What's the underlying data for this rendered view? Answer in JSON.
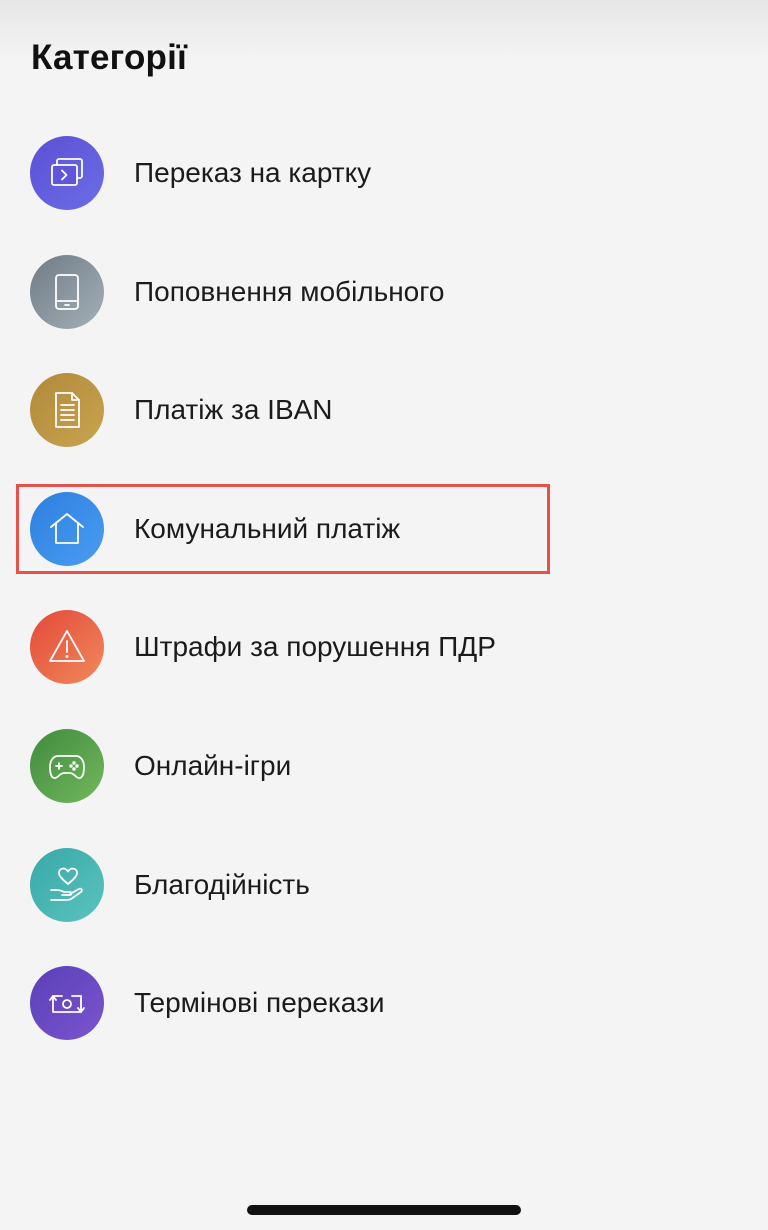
{
  "header": {
    "title": "Категорії"
  },
  "categories": [
    {
      "label": "Переказ на картку",
      "icon": "card-transfer-icon",
      "color_from": "#5b4fd6",
      "color_to": "#6c6ee6"
    },
    {
      "label": "Поповнення мобільного",
      "icon": "mobile-phone-icon",
      "color_from": "#6f7c86",
      "color_to": "#a3b0b8"
    },
    {
      "label": "Платіж за IBAN",
      "icon": "document-icon",
      "color_from": "#b08a3a",
      "color_to": "#c9a34f"
    },
    {
      "label": "Комунальний платіж",
      "icon": "home-icon",
      "color_from": "#2d7fe0",
      "color_to": "#4a9df0"
    },
    {
      "label": "Штрафи за порушення ПДР",
      "icon": "warning-icon",
      "color_from": "#e4483a",
      "color_to": "#f08a5a"
    },
    {
      "label": "Онлайн-ігри",
      "icon": "gamepad-icon",
      "color_from": "#3f8b3f",
      "color_to": "#72b85b"
    },
    {
      "label": "Благодійність",
      "icon": "charity-hand-heart-icon",
      "color_from": "#37a8a8",
      "color_to": "#5cc3be"
    },
    {
      "label": "Термінові перекази",
      "icon": "urgent-transfer-icon",
      "color_from": "#5a3fb8",
      "color_to": "#7b55cf"
    }
  ],
  "highlight": {
    "color": "#e5524b"
  }
}
